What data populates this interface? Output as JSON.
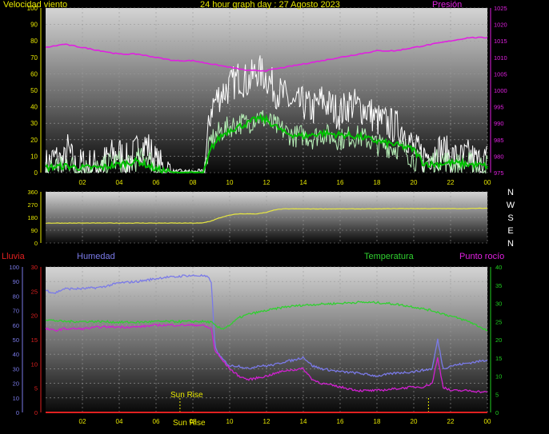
{
  "header": {
    "wind_label": "Velocidad viento",
    "title": "24 hour graph day : 27 Agosto 2023",
    "pressure_label": "Presión"
  },
  "lower_header": {
    "rain_label": "Lluvia",
    "humidity_label": "Humedad",
    "temperature_label": "Temperatura",
    "dewpoint_label": "Punto rocío"
  },
  "colors": {
    "wind_speed": "#ffffff",
    "wind_gust": "#b8f0b8",
    "wind_avg": "#00c000",
    "pressure": "#e020e0",
    "direction": "#e8e840",
    "humidity": "#7a7ae8",
    "temperature": "#30d030",
    "dewpoint": "#d020d0",
    "rain": "#e02020",
    "axis_yellow": "#e8e800",
    "axis_green": "#20d020",
    "axis_red": "#e02020"
  },
  "annotations": {
    "sunrise_label": "Sun Rise",
    "sunrise_hour": 7.3,
    "sunset_hour": 20.8,
    "sun_bottom_label": "Sun Rise"
  },
  "chart_data": [
    {
      "type": "line",
      "title": "24 hour graph day : 27 Agosto 2023",
      "x_ticks": [
        "02",
        "04",
        "06",
        "08",
        "10",
        "12",
        "14",
        "16",
        "18",
        "20",
        "22",
        "00"
      ],
      "xlim": [
        0,
        24
      ],
      "y_left_label": "Velocidad viento",
      "ylim_left": [
        0,
        100
      ],
      "y_left_ticks": [
        0,
        10,
        20,
        30,
        40,
        50,
        60,
        70,
        80,
        90,
        100
      ],
      "y_right_label": "Presión",
      "ylim_right": [
        975,
        1025
      ],
      "y_right_ticks": [
        975,
        980,
        985,
        990,
        995,
        1000,
        1005,
        1010,
        1015,
        1020,
        1025
      ],
      "series": [
        {
          "name": "Gust",
          "axis": "left",
          "x": [
            0,
            0.5,
            1,
            1.2,
            1.6,
            2,
            3,
            3.5,
            4,
            4.5,
            5,
            5.5,
            6,
            6.5,
            7,
            8,
            8.6,
            9,
            9.5,
            10,
            10.5,
            11,
            11.5,
            12,
            12.5,
            13,
            13.5,
            14,
            14.5,
            15,
            15.5,
            16,
            16.5,
            17,
            17.5,
            18,
            18.5,
            19,
            19.5,
            20,
            20.5,
            21,
            21.5,
            22,
            22.5,
            23,
            23.5,
            24
          ],
          "y": [
            4,
            9,
            6,
            14,
            3,
            5,
            4,
            10,
            12,
            6,
            14,
            17,
            6,
            1,
            0,
            0,
            0,
            40,
            48,
            52,
            58,
            55,
            62,
            58,
            50,
            46,
            40,
            42,
            38,
            44,
            40,
            36,
            42,
            40,
            38,
            32,
            30,
            28,
            26,
            14,
            10,
            12,
            14,
            10,
            8,
            10,
            6,
            8
          ]
        },
        {
          "name": "Speed",
          "axis": "left",
          "x": [
            0,
            0.5,
            1,
            1.2,
            1.6,
            2,
            3,
            3.5,
            4,
            4.5,
            5,
            5.5,
            6,
            6.5,
            7,
            8,
            8.6,
            9,
            9.5,
            10,
            10.5,
            11,
            11.5,
            12,
            12.5,
            13,
            13.5,
            14,
            14.5,
            15,
            15.5,
            16,
            16.5,
            17,
            17.5,
            18,
            18.5,
            19,
            19.5,
            20,
            20.5,
            21,
            21.5,
            22,
            22.5,
            23,
            23.5,
            24
          ],
          "y": [
            2,
            5,
            3,
            8,
            2,
            3,
            2,
            6,
            7,
            4,
            8,
            10,
            3,
            0,
            0,
            0,
            0,
            20,
            25,
            28,
            30,
            30,
            34,
            32,
            28,
            25,
            22,
            23,
            21,
            24,
            22,
            20,
            22,
            22,
            20,
            17,
            16,
            15,
            14,
            8,
            6,
            7,
            8,
            6,
            5,
            6,
            4,
            5
          ]
        },
        {
          "name": "Average",
          "axis": "left",
          "x": [
            0,
            1,
            2,
            3,
            4,
            5,
            6,
            7,
            8,
            8.6,
            9,
            9.5,
            10,
            10.5,
            11,
            11.5,
            12,
            12.5,
            13,
            14,
            15,
            16,
            17,
            18,
            19,
            20,
            20.5,
            21,
            22,
            23,
            24
          ],
          "y": [
            3,
            4,
            3,
            3,
            5,
            7,
            2,
            0,
            0,
            0,
            15,
            22,
            26,
            28,
            30,
            33,
            32,
            28,
            24,
            22,
            24,
            23,
            22,
            19,
            17,
            14,
            6,
            5,
            6,
            5,
            4
          ]
        },
        {
          "name": "Presión",
          "axis": "right",
          "x": [
            0,
            1,
            2,
            3,
            4,
            5,
            6,
            7,
            8,
            9,
            10,
            11,
            12,
            13,
            14,
            15,
            16,
            17,
            18,
            19,
            20,
            21,
            22,
            23,
            24
          ],
          "y": [
            1013,
            1014,
            1013,
            1012,
            1011,
            1011,
            1010,
            1009,
            1009,
            1008,
            1007,
            1006,
            1006,
            1007,
            1008,
            1009,
            1010,
            1011,
            1012,
            1012,
            1013,
            1014,
            1015,
            1016,
            1016
          ]
        }
      ]
    },
    {
      "type": "line",
      "xlim": [
        0,
        24
      ],
      "ylim": [
        0,
        360
      ],
      "y_ticks": [
        0,
        90,
        180,
        270,
        360
      ],
      "right_labels": [
        "N",
        "W",
        "S",
        "E",
        "N"
      ],
      "series": [
        {
          "name": "Direction",
          "x": [
            0,
            1,
            2,
            3,
            4,
            5,
            6,
            7,
            8,
            8.5,
            9,
            9.3,
            9.8,
            10.2,
            10.5,
            11,
            11.5,
            12,
            12.5,
            13,
            14,
            15,
            16,
            17,
            18,
            19,
            20,
            21,
            22,
            23,
            24
          ],
          "y": [
            140,
            140,
            140,
            140,
            140,
            140,
            140,
            140,
            140,
            140,
            155,
            170,
            190,
            200,
            205,
            205,
            205,
            215,
            235,
            240,
            240,
            240,
            240,
            240,
            240,
            242,
            242,
            242,
            242,
            242,
            245
          ]
        }
      ]
    },
    {
      "type": "line",
      "xlim": [
        0,
        24
      ],
      "x_ticks": [
        "02",
        "04",
        "06",
        "08",
        "10",
        "12",
        "14",
        "16",
        "18",
        "20",
        "22",
        "00"
      ],
      "y_left_label": "Humedad",
      "ylim_left": [
        0,
        100
      ],
      "y_left_ticks": [
        0,
        10,
        20,
        30,
        40,
        50,
        60,
        70,
        80,
        90,
        100
      ],
      "y_left2_label": "Lluvia",
      "ylim_left2": [
        0,
        30
      ],
      "y_left2_ticks": [
        0,
        5,
        10,
        15,
        20,
        25,
        30
      ],
      "y_right_label": "Temperatura",
      "ylim_right": [
        0,
        40
      ],
      "y_right_ticks": [
        0,
        5,
        10,
        15,
        20,
        25,
        30,
        35,
        40
      ],
      "series": [
        {
          "name": "Humedad",
          "axis": "left",
          "x": [
            0,
            0.5,
            1,
            2,
            3,
            4,
            5,
            6,
            6.5,
            7,
            7.5,
            8,
            8.5,
            8.8,
            9,
            9.2,
            9.5,
            10,
            10.5,
            11,
            11.5,
            12,
            12.5,
            13,
            13.5,
            14,
            14.5,
            15,
            16,
            17,
            18,
            19,
            20,
            20.5,
            21,
            21.3,
            21.6,
            22,
            23,
            24
          ],
          "y": [
            84,
            82,
            85,
            85,
            86,
            89,
            90,
            92,
            93,
            93,
            94,
            94,
            94,
            93,
            90,
            45,
            38,
            32,
            32,
            30,
            32,
            32,
            33,
            35,
            36,
            38,
            32,
            30,
            28,
            27,
            25,
            27,
            28,
            29,
            30,
            50,
            30,
            32,
            34,
            36
          ]
        },
        {
          "name": "Temperatura",
          "axis": "right",
          "x": [
            0,
            1,
            2,
            3,
            4,
            5,
            6,
            7,
            8,
            8.5,
            9,
            9.3,
            9.6,
            10,
            10.5,
            11,
            12,
            13,
            14,
            15,
            16,
            17,
            18,
            19,
            20,
            21,
            22,
            23,
            24
          ],
          "y": [
            25.5,
            25,
            25,
            25,
            24.8,
            24.8,
            25,
            25,
            25,
            25,
            24.8,
            23.5,
            23,
            24,
            26,
            27,
            28,
            29,
            29.5,
            29.8,
            30,
            30.3,
            30.2,
            29.8,
            29,
            28,
            26.5,
            25,
            22.5
          ]
        },
        {
          "name": "Punto rocío",
          "axis": "right",
          "x": [
            0,
            0.5,
            1,
            2,
            3,
            4,
            5,
            6,
            7,
            8,
            8.5,
            9,
            9.2,
            9.5,
            10,
            10.5,
            11,
            12,
            13,
            14,
            14.5,
            15,
            16,
            17,
            18,
            19,
            20,
            20.5,
            21,
            21.3,
            21.6,
            22,
            23,
            24
          ],
          "y": [
            23,
            22.5,
            23,
            23,
            23.5,
            23.5,
            23.5,
            24,
            24,
            24,
            24,
            23,
            17,
            15,
            12,
            10,
            9,
            10,
            11.5,
            12,
            9,
            8,
            7,
            6,
            6,
            6.5,
            7,
            7,
            8,
            15,
            7,
            6,
            6,
            5.5
          ]
        },
        {
          "name": "Lluvia",
          "axis": "left2",
          "x": [
            0,
            24
          ],
          "y": [
            0,
            0
          ]
        }
      ]
    }
  ]
}
